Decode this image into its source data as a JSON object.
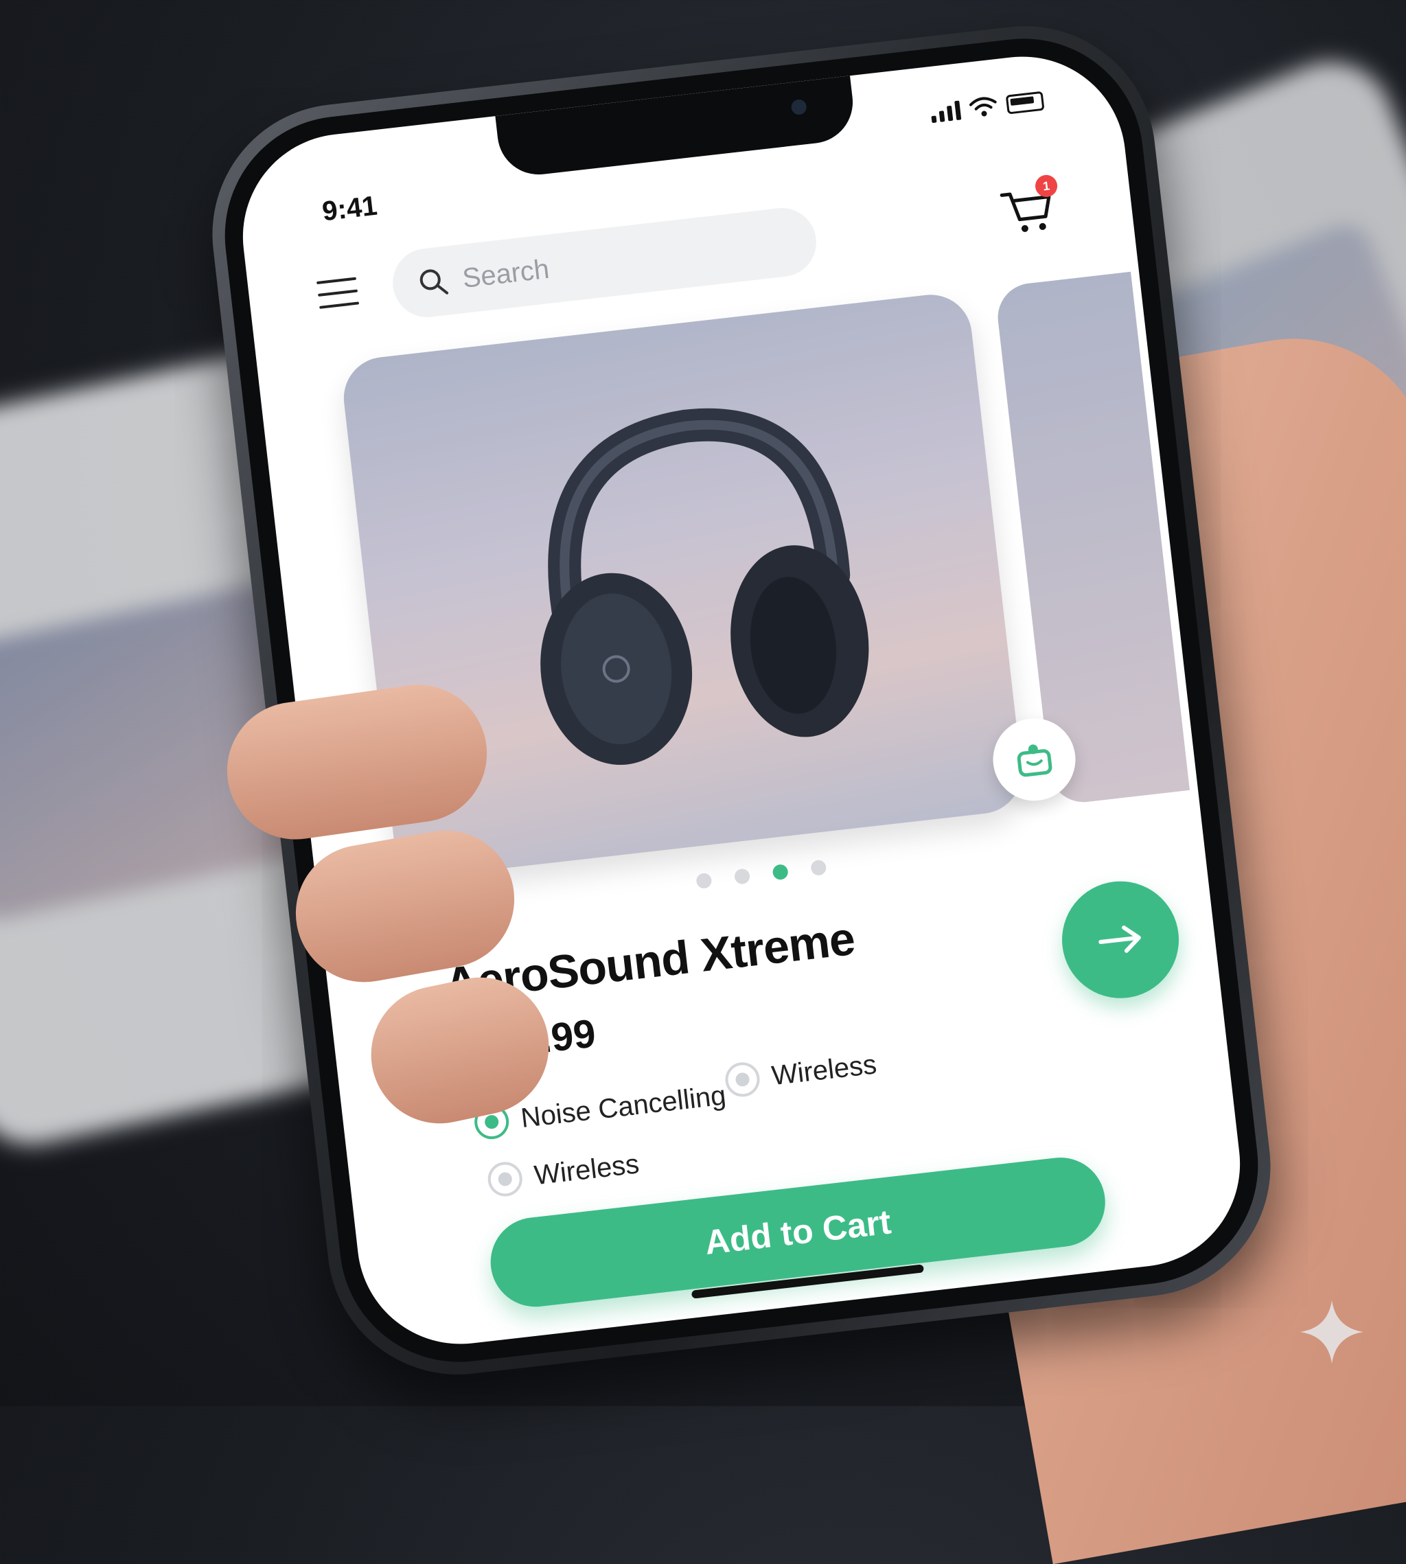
{
  "status_bar": {
    "time": "9:41"
  },
  "header": {
    "search_placeholder": "Search",
    "cart_badge": "1"
  },
  "carousel": {
    "dot_count": 4,
    "active_index": 2
  },
  "product": {
    "title": "AeroSound Xtreme",
    "price": "$199.99",
    "options": [
      {
        "label": "Noise Cancelling",
        "selected": true
      },
      {
        "label": "Wireless",
        "selected": false
      },
      {
        "label": "Wireless",
        "selected": false
      }
    ],
    "add_to_cart_label": "Add to Cart"
  },
  "colors": {
    "accent": "#3dbb87",
    "badge": "#ef4444",
    "text": "#111111"
  }
}
